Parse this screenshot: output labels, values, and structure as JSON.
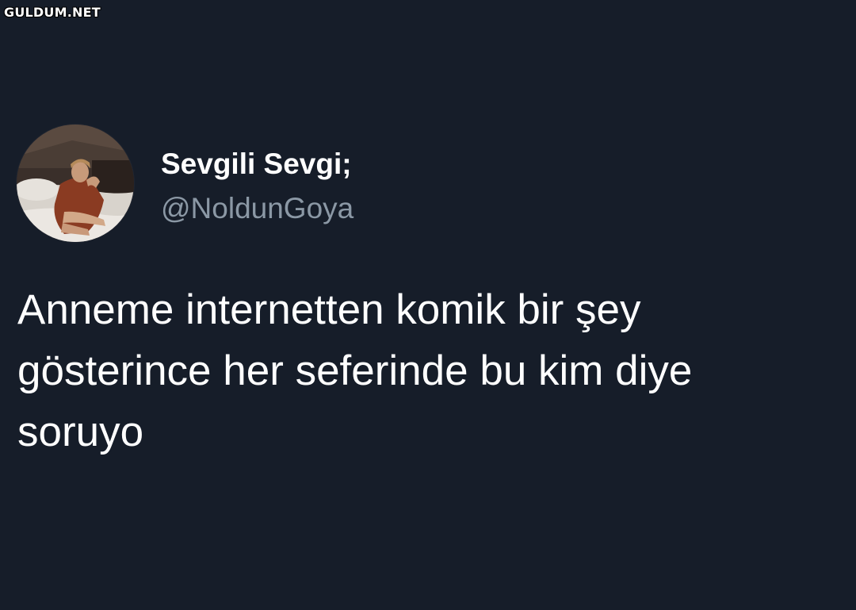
{
  "watermark": "GULDUM.NET",
  "tweet": {
    "author": {
      "display_name": "Sevgili Sevgi;",
      "handle": "@NoldunGoya",
      "avatar_icon": "profile-photo"
    },
    "text_lines": [
      "Anneme internetten komik bir şey",
      "gösterince her seferinde bu kim diye",
      "soruyo"
    ]
  },
  "colors": {
    "background": "#161d29",
    "name": "#ffffff",
    "handle": "#8b98a5",
    "text": "#ffffff"
  }
}
